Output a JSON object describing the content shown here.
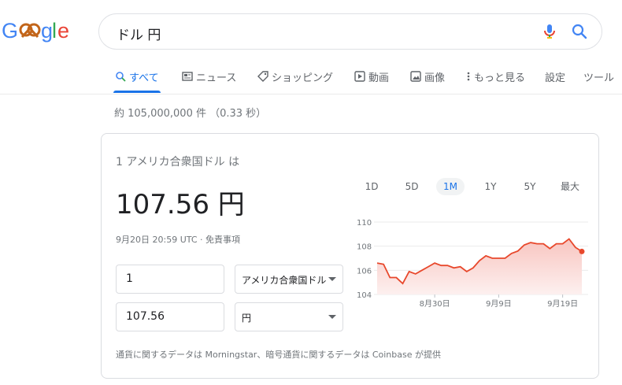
{
  "search": {
    "query": "ドル 円"
  },
  "tabs": [
    {
      "label": "すべて",
      "icon": "search-icon",
      "active": true
    },
    {
      "label": "ニュース",
      "icon": "news-icon"
    },
    {
      "label": "ショッピング",
      "icon": "tag-icon"
    },
    {
      "label": "動画",
      "icon": "play-icon"
    },
    {
      "label": "画像",
      "icon": "image-icon"
    },
    {
      "label": "もっと見る",
      "icon": "more-vert-icon"
    },
    {
      "label": "設定"
    },
    {
      "label": "ツール"
    }
  ],
  "stats": "約 105,000,000 件 （0.33 秒）",
  "converter": {
    "from_label": "1 アメリカ合衆国ドル は",
    "big_value": "107.56 円",
    "meta": "9月20日 20:59 UTC · 免責事項",
    "from_amount": "1",
    "from_currency": "アメリカ合衆国ドル",
    "to_amount": "107.56",
    "to_currency": "円",
    "ranges": [
      "1D",
      "5D",
      "1M",
      "1Y",
      "5Y",
      "最大"
    ],
    "active_range": "1M",
    "footer": "通貨に関するデータは Morningstar、暗号通貨に関するデータは Coinbase が提供"
  },
  "colors": {
    "accent": "#1a73e8",
    "line": "#e8482c",
    "fill": "#fce8e6"
  },
  "chart_data": {
    "type": "area",
    "ylim": [
      104,
      110
    ],
    "yticks": [
      "110",
      "108",
      "106",
      "104"
    ],
    "xticks": [
      {
        "label": "8月30日",
        "index": 9
      },
      {
        "label": "9月9日",
        "index": 19
      },
      {
        "label": "9月19日",
        "index": 29
      }
    ],
    "values": [
      106.6,
      106.5,
      105.4,
      105.4,
      104.9,
      105.9,
      105.7,
      106.0,
      106.3,
      106.6,
      106.4,
      106.4,
      106.2,
      106.3,
      105.9,
      106.2,
      106.8,
      107.2,
      107.0,
      107.0,
      107.0,
      107.4,
      107.6,
      108.1,
      108.3,
      108.2,
      108.2,
      107.8,
      108.2,
      108.2,
      108.6,
      107.9,
      107.56
    ]
  }
}
